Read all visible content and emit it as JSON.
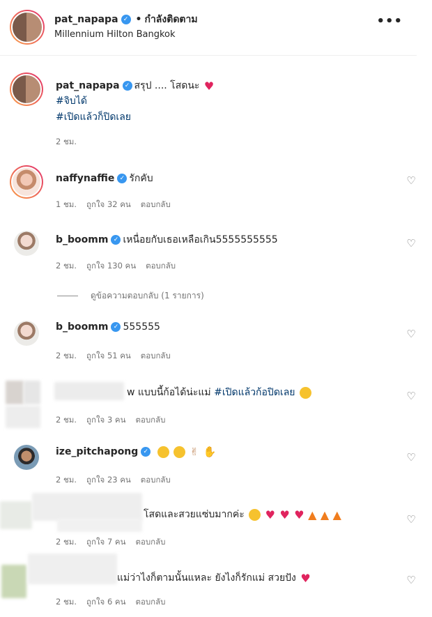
{
  "header": {
    "username": "pat_napapa",
    "separator": "•",
    "follow_status": "กำลังติดตาม",
    "location": "Millennium Hilton Bangkok",
    "more_icon": "more-icon"
  },
  "caption": {
    "username": "pat_napapa",
    "text": "สรุป .... โสดนะ",
    "hashtag_1": "#จิบได้",
    "hashtag_2": "#เปิดแล้วก็ปิดเลย",
    "time": "2 ชม."
  },
  "comments": [
    {
      "username": "naffynaffie",
      "text": "รักคับ",
      "time": "1 ชม.",
      "likes": "ถูกใจ 32 คน",
      "reply": "ตอบกลับ"
    },
    {
      "username": "b_boomm",
      "text": "เหนื่อยกับเธอเหลือเกิน5555555555",
      "time": "2 ชม.",
      "likes": "ถูกใจ 130 คน",
      "reply": "ตอบกลับ",
      "view_replies": "ดูข้อความตอบกลับ (1 รายการ)"
    },
    {
      "username": "b_boomm",
      "text": "555555",
      "time": "2 ชม.",
      "likes": "ถูกใจ 51 คน",
      "reply": "ตอบกลับ"
    },
    {
      "username": "",
      "text_prefix": "w",
      "text": "แบบนี้ก้อได้น่ะแม่",
      "hashtag": "#เปิดแล้วก้อปิดเลย",
      "time": "2 ชม.",
      "likes": "ถูกใจ 3 คน",
      "reply": "ตอบกลับ"
    },
    {
      "username": "ize_pitchapong",
      "text": "",
      "time": "2 ชม.",
      "likes": "ถูกใจ 23 คน",
      "reply": "ตอบกลับ"
    },
    {
      "username": "",
      "text": "โสดและสวยแซ่บมากค่ะ",
      "time": "2 ชม.",
      "likes": "ถูกใจ 7 คน",
      "reply": "ตอบกลับ"
    },
    {
      "username": "",
      "text": "แม่ว่าไงก็ตามนั้นแหละ ยังไงก็รักแม่ สวยปัง",
      "time": "2 ชม.",
      "likes": "ถูกใจ 6 คน",
      "reply": "ตอบกลับ"
    }
  ],
  "icons": {
    "verified": "verified-badge-icon",
    "like": "heart-outline-icon"
  },
  "colors": {
    "hashtag": "#00376b",
    "verified": "#3897f0",
    "meta": "#737373"
  }
}
